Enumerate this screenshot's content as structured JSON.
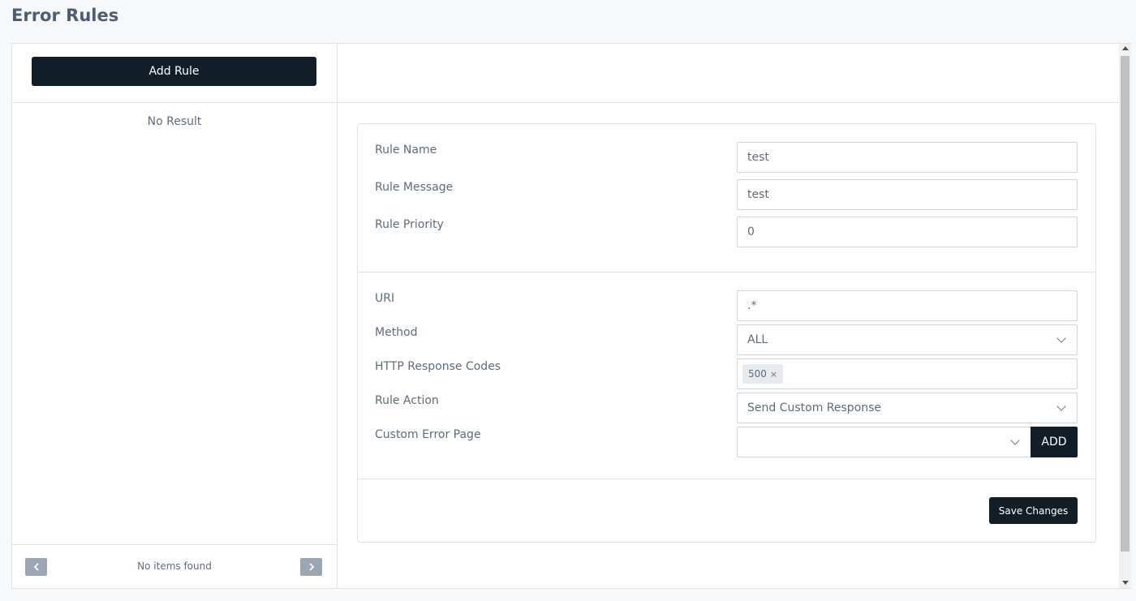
{
  "page": {
    "title": "Error Rules"
  },
  "sidebar": {
    "add_rule_label": "Add Rule",
    "empty_text": "No Result",
    "pagination": {
      "prev_icon": "chevron-left-icon",
      "next_icon": "chevron-right-icon",
      "status": "No items found"
    }
  },
  "form": {
    "rule_name": {
      "label": "Rule Name",
      "value": "test"
    },
    "rule_message": {
      "label": "Rule Message",
      "value": "test"
    },
    "rule_priority": {
      "label": "Rule Priority",
      "value": "0"
    },
    "uri": {
      "label": "URI",
      "value": ".*"
    },
    "method": {
      "label": "Method",
      "value": "ALL"
    },
    "http_codes": {
      "label": "HTTP Response Codes",
      "tags": [
        "500"
      ],
      "remove_glyph": "×"
    },
    "rule_action": {
      "label": "Rule Action",
      "value": "Send Custom Response"
    },
    "custom_error_page": {
      "label": "Custom Error Page",
      "value": "",
      "add_label": "ADD"
    },
    "save_label": "Save Changes"
  },
  "colors": {
    "primary_button": "#111e27",
    "border": "#dfe3e8",
    "text": "#5f6b7a"
  }
}
